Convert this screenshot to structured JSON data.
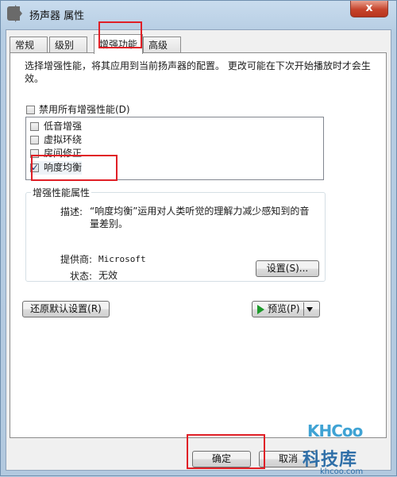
{
  "window": {
    "title": "扬声器 属性",
    "close_symbol": "x"
  },
  "tabs": [
    {
      "label": "常规"
    },
    {
      "label": "级别"
    },
    {
      "label": "增强功能"
    },
    {
      "label": "高级"
    }
  ],
  "enhancements": {
    "description": "选择增强性能，将其应用到当前扬声器的配置。 更改可能在下次开始播放时才会生效。",
    "disable_all_label": "禁用所有增强性能(D)",
    "disable_all_checked": false,
    "items": [
      {
        "label": "低音增强",
        "checked": false
      },
      {
        "label": "虚拟环绕",
        "checked": false
      },
      {
        "label": "房间修正",
        "checked": false
      },
      {
        "label": "响度均衡",
        "checked": true
      }
    ]
  },
  "properties": {
    "group_label": "增强性能属性",
    "description_label": "描述:",
    "description_value": "“响度均衡”运用对人类听觉的理解力减少感知到的音量差别。",
    "provider_label": "提供商:",
    "provider_value": "Microsoft",
    "status_label": "状态:",
    "status_value": "无效",
    "settings_button": "设置(S)..."
  },
  "actions": {
    "restore_defaults": "还原默认设置(R)",
    "preview": "预览(P)"
  },
  "footer": {
    "ok": "确定",
    "cancel": "取消"
  },
  "watermark": {
    "logo": "KHCoo",
    "name": "科技库",
    "url": "khcoo.com"
  },
  "colors": {
    "highlight": "#e01f26",
    "play_icon": "#1d9a2b"
  }
}
